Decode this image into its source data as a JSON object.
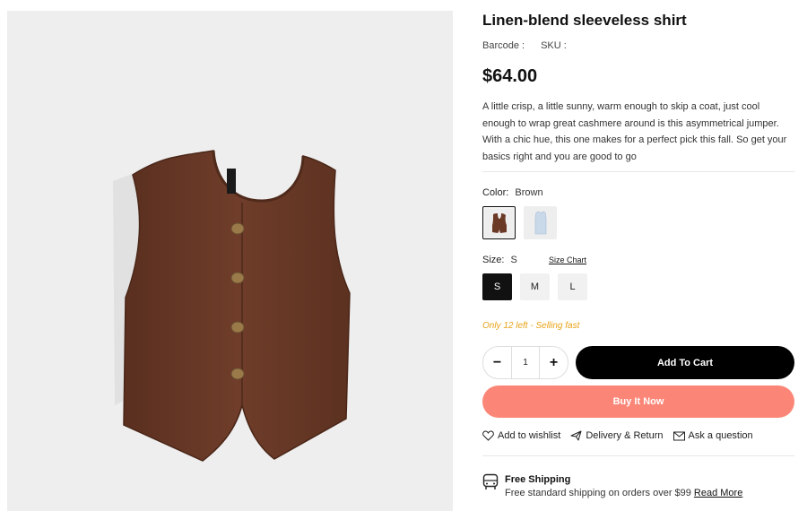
{
  "product": {
    "title": "Linen-blend sleeveless shirt",
    "barcode_label": "Barcode :",
    "sku_label": "SKU :",
    "price": "$64.00",
    "description": "A little crisp, a little sunny, warm enough to skip a coat, just cool enough to wrap great cashmere around is this asymmetrical jumper. With a chic hue, this one makes for a perfect pick this fall. So get your basics right and you are good to go"
  },
  "color": {
    "label": "Color:",
    "selected": "Brown",
    "swatches": [
      {
        "name": "Brown",
        "hex": "#6b3a27"
      },
      {
        "name": "Light Blue",
        "hex": "#c9d9ea"
      }
    ]
  },
  "size": {
    "label": "Size:",
    "selected": "S",
    "chart_link": "Size Chart",
    "options": [
      "S",
      "M",
      "L"
    ]
  },
  "stock": {
    "text": "Only 12 left - Selling fast"
  },
  "quantity": {
    "minus": "−",
    "value": "1",
    "plus": "+"
  },
  "actions": {
    "add_to_cart": "Add To Cart",
    "buy_now": "Buy It Now"
  },
  "links": {
    "wishlist": "Add to wishlist",
    "delivery": "Delivery & Return",
    "question": "Ask a question"
  },
  "shipping": {
    "title": "Free Shipping",
    "text": "Free standard shipping on orders over $99",
    "link": "Read More"
  },
  "colors": {
    "buy_now_bg": "#fb8677",
    "stock_text": "#e8a317",
    "garment": "#6b3a27"
  }
}
